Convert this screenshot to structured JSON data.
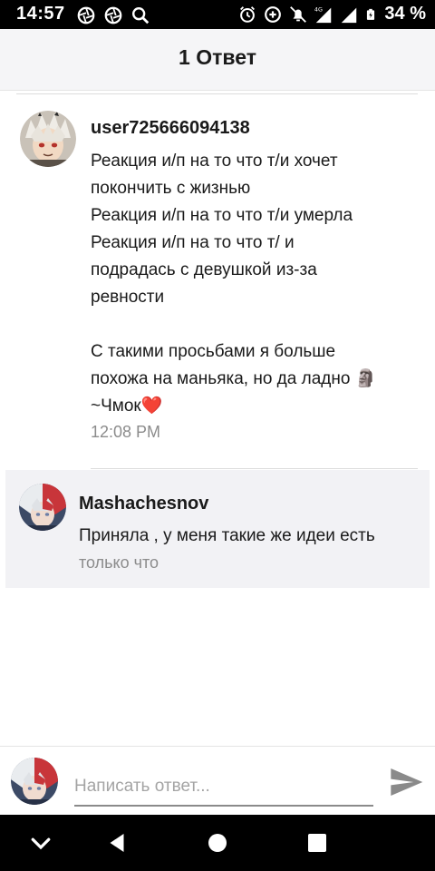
{
  "status_bar": {
    "time": "14:57",
    "battery_percent": "34 %",
    "network_label": "4G",
    "left_icons": [
      "aperture-icon",
      "aperture-icon",
      "search-icon"
    ],
    "right_icons": [
      "alarm-icon",
      "data-saver-icon",
      "notifications-off-icon",
      "signal-icon",
      "signal-icon",
      "battery-icon"
    ]
  },
  "header": {
    "title": "1 Ответ"
  },
  "comment": {
    "author": "user725666094138",
    "lines": [
      "Реакция и/п на то что т/и хочет",
      "покончить с жизнью",
      "Реакция и/п на то что т/и умерла",
      "Реакция и/п на то что т/ и",
      "подрадась с девушкой из-за",
      "ревности",
      "",
      "С такими просьбами я больше",
      "похожа на маньяка, но да ладно 🗿",
      "~Чмок❤️"
    ],
    "time": "12:08 PM"
  },
  "reply": {
    "author": "Mashachesnov",
    "text": "Приняла , у меня такие же идеи есть",
    "time": "только что"
  },
  "input": {
    "placeholder": "Написать ответ..."
  },
  "colors": {
    "accent_red": "#e0404a",
    "header_bg": "#f5f5f7",
    "reply_bg": "#f2f2f5",
    "muted_text": "#8c8c8c"
  },
  "nav": {
    "buttons": [
      "chevron-down-icon",
      "back-icon",
      "home-icon",
      "recents-icon"
    ]
  }
}
